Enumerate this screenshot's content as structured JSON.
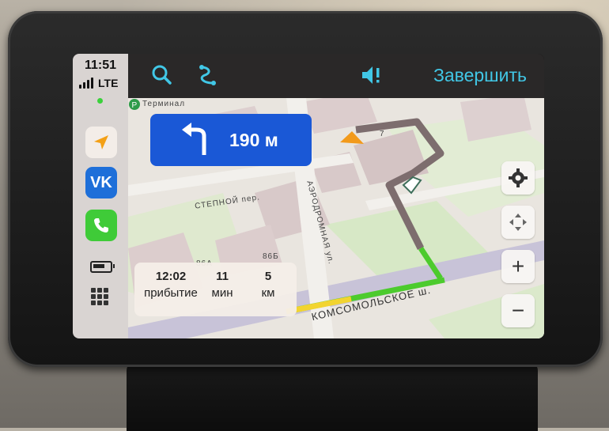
{
  "status": {
    "time": "11:51",
    "network": "LTE"
  },
  "dock": {
    "apps": [
      {
        "name": "navigator",
        "icon": "navigation-arrow-icon"
      },
      {
        "name": "vk",
        "label": "VK",
        "icon": "vk-logo-icon"
      },
      {
        "name": "phone",
        "icon": "phone-icon"
      }
    ]
  },
  "toolbar": {
    "search_icon": "search-icon",
    "route_icon": "route-icon",
    "sound_icon": "sound-alert-icon",
    "finish_label": "Завершить"
  },
  "maneuver": {
    "direction": "turn-left",
    "distance": "190 м"
  },
  "eta": {
    "arrival_time": "12:02",
    "arrival_label": "прибытие",
    "duration": "11",
    "duration_label": "мин",
    "remaining": "5",
    "remaining_label": "км"
  },
  "map": {
    "poi_label": "Терминал",
    "streets": [
      "СТЕПНОЙ пер.",
      "АЭРОДРОМНАЯ ул.",
      "КОМСОМОЛЬСКОЕ ш."
    ],
    "buildings": [
      "86А",
      "86Б",
      "7"
    ]
  },
  "map_controls": {
    "zoom_in": "+",
    "zoom_out": "−"
  },
  "colors": {
    "accent": "#41c7e6",
    "maneuver_bg": "#1a58d6",
    "route": "#7a6a6a",
    "traffic_green": "#4ccb2d",
    "traffic_red": "#e0262a"
  }
}
